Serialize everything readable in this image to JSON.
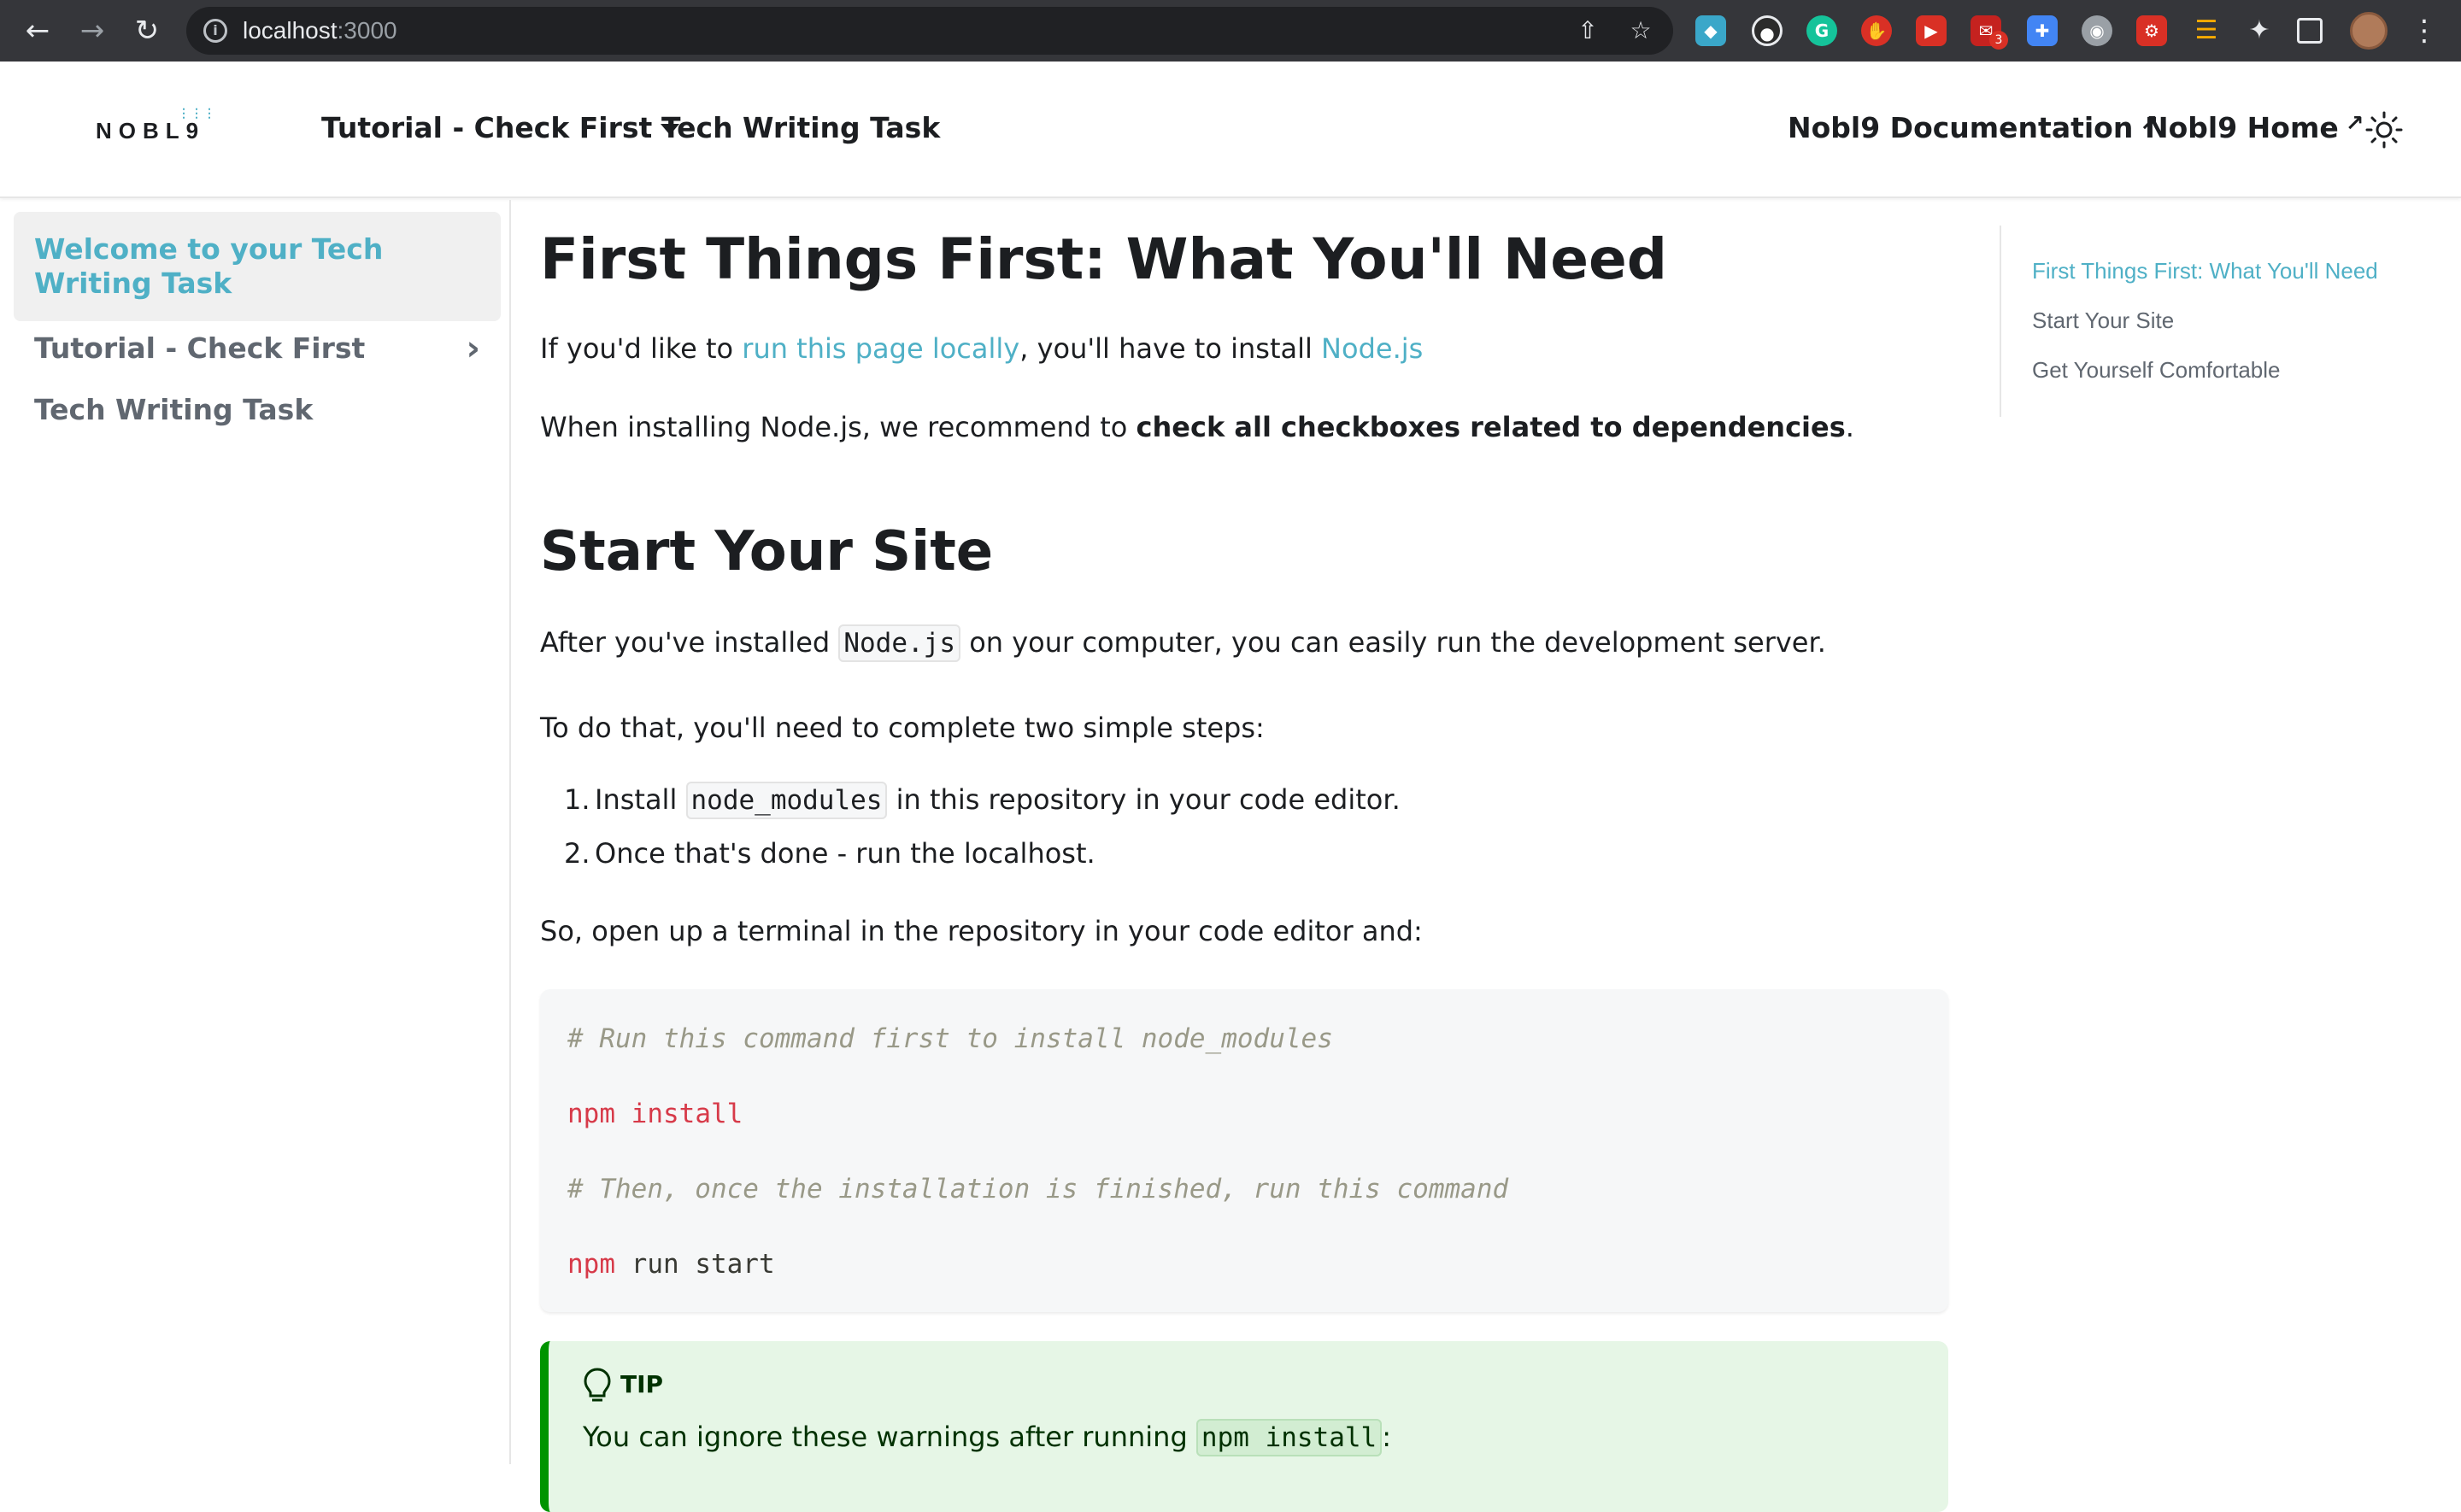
{
  "browser": {
    "url_host": "localhost",
    "url_port": ":3000",
    "ext_badge": "3"
  },
  "navbar": {
    "logo": "NOBL9",
    "items": [
      {
        "label": "Tutorial - Check First"
      },
      {
        "label": "Tech Writing Task"
      }
    ],
    "right_links": [
      {
        "label": "Nobl9 Documentation"
      },
      {
        "label": "Nobl9 Home"
      }
    ]
  },
  "sidebar": {
    "items": [
      {
        "label": "Welcome to your Tech Writing Task",
        "active": true
      },
      {
        "label": "Tutorial - Check First",
        "has_children": true
      },
      {
        "label": "Tech Writing Task"
      }
    ]
  },
  "content": {
    "title": "First Things First: What You'll Need",
    "p1": {
      "pre": "If you'd like to ",
      "link1": "run this page locally",
      "mid": ", you'll have to install ",
      "link2": "Node.js"
    },
    "p2": {
      "pre": "When installing Node.js, we recommend to ",
      "bold": "check all checkboxes related to dependencies",
      "post": "."
    },
    "heading2": "Start Your Site",
    "p3": {
      "pre": "After you've installed ",
      "code": "Node.js",
      "post": " on your computer, you can easily run the development server."
    },
    "p4": "To do that, you'll need to complete two simple steps:",
    "steps": [
      {
        "num": "1.",
        "pre": "Install ",
        "code": "node_modules",
        "post": " in this repository in your code editor."
      },
      {
        "num": "2.",
        "text": "Once that's done - run the localhost."
      }
    ],
    "p5": "So, open up a terminal in the repository in your code editor and:",
    "code": {
      "comment1": "# Run this command first to install node_modules",
      "cmd1_kw": "npm",
      "cmd1_rest": " install",
      "comment2": "# Then, once the installation is finished, run this command",
      "cmd2_kw": "npm",
      "cmd2_rest": " run start"
    },
    "tip": {
      "label": "TIP",
      "pre": "You can ignore these warnings after running ",
      "code": "npm install",
      "post": ":"
    }
  },
  "toc": {
    "items": [
      {
        "label": "First Things First: What You'll Need",
        "active": true
      },
      {
        "label": "Start Your Site"
      },
      {
        "label": "Get Yourself Comfortable"
      }
    ]
  },
  "colors": {
    "accent": "#4fb0c6",
    "tip_border": "#009400",
    "code_keyword": "#d73a49"
  }
}
